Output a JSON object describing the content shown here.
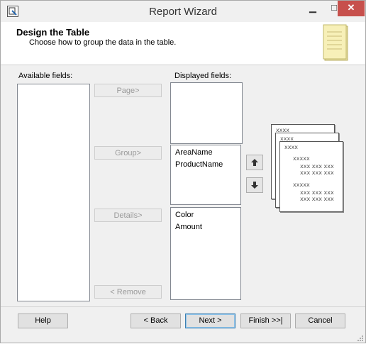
{
  "window": {
    "title": "Report Wizard",
    "min_glyph": "▁",
    "max_glyph": "□",
    "close_glyph": "✕"
  },
  "header": {
    "title": "Design the Table",
    "subtitle": "Choose how to group the data in the table."
  },
  "available": {
    "label": "Available fields:",
    "items": []
  },
  "displayed": {
    "label": "Displayed fields:",
    "page_items": [],
    "group_items": [
      "AreaName",
      "ProductName"
    ],
    "detail_items": [
      "Color",
      "Amount"
    ]
  },
  "move_buttons": {
    "page": "Page>",
    "group": "Group>",
    "details": "Details>",
    "remove": "< Remove"
  },
  "preview": {
    "card1": "xxxx",
    "card2": "xxxx",
    "card3_title": "xxxx",
    "group1_head": "xxxxx",
    "group1_rows": "xxx xxx xxx\nxxx xxx xxx",
    "group2_head": "xxxxx",
    "group2_rows": "xxx xxx xxx\nxxx xxx xxx"
  },
  "footer": {
    "help": "Help",
    "back": "< Back",
    "next": "Next >",
    "finish": "Finish >>|",
    "cancel": "Cancel"
  }
}
